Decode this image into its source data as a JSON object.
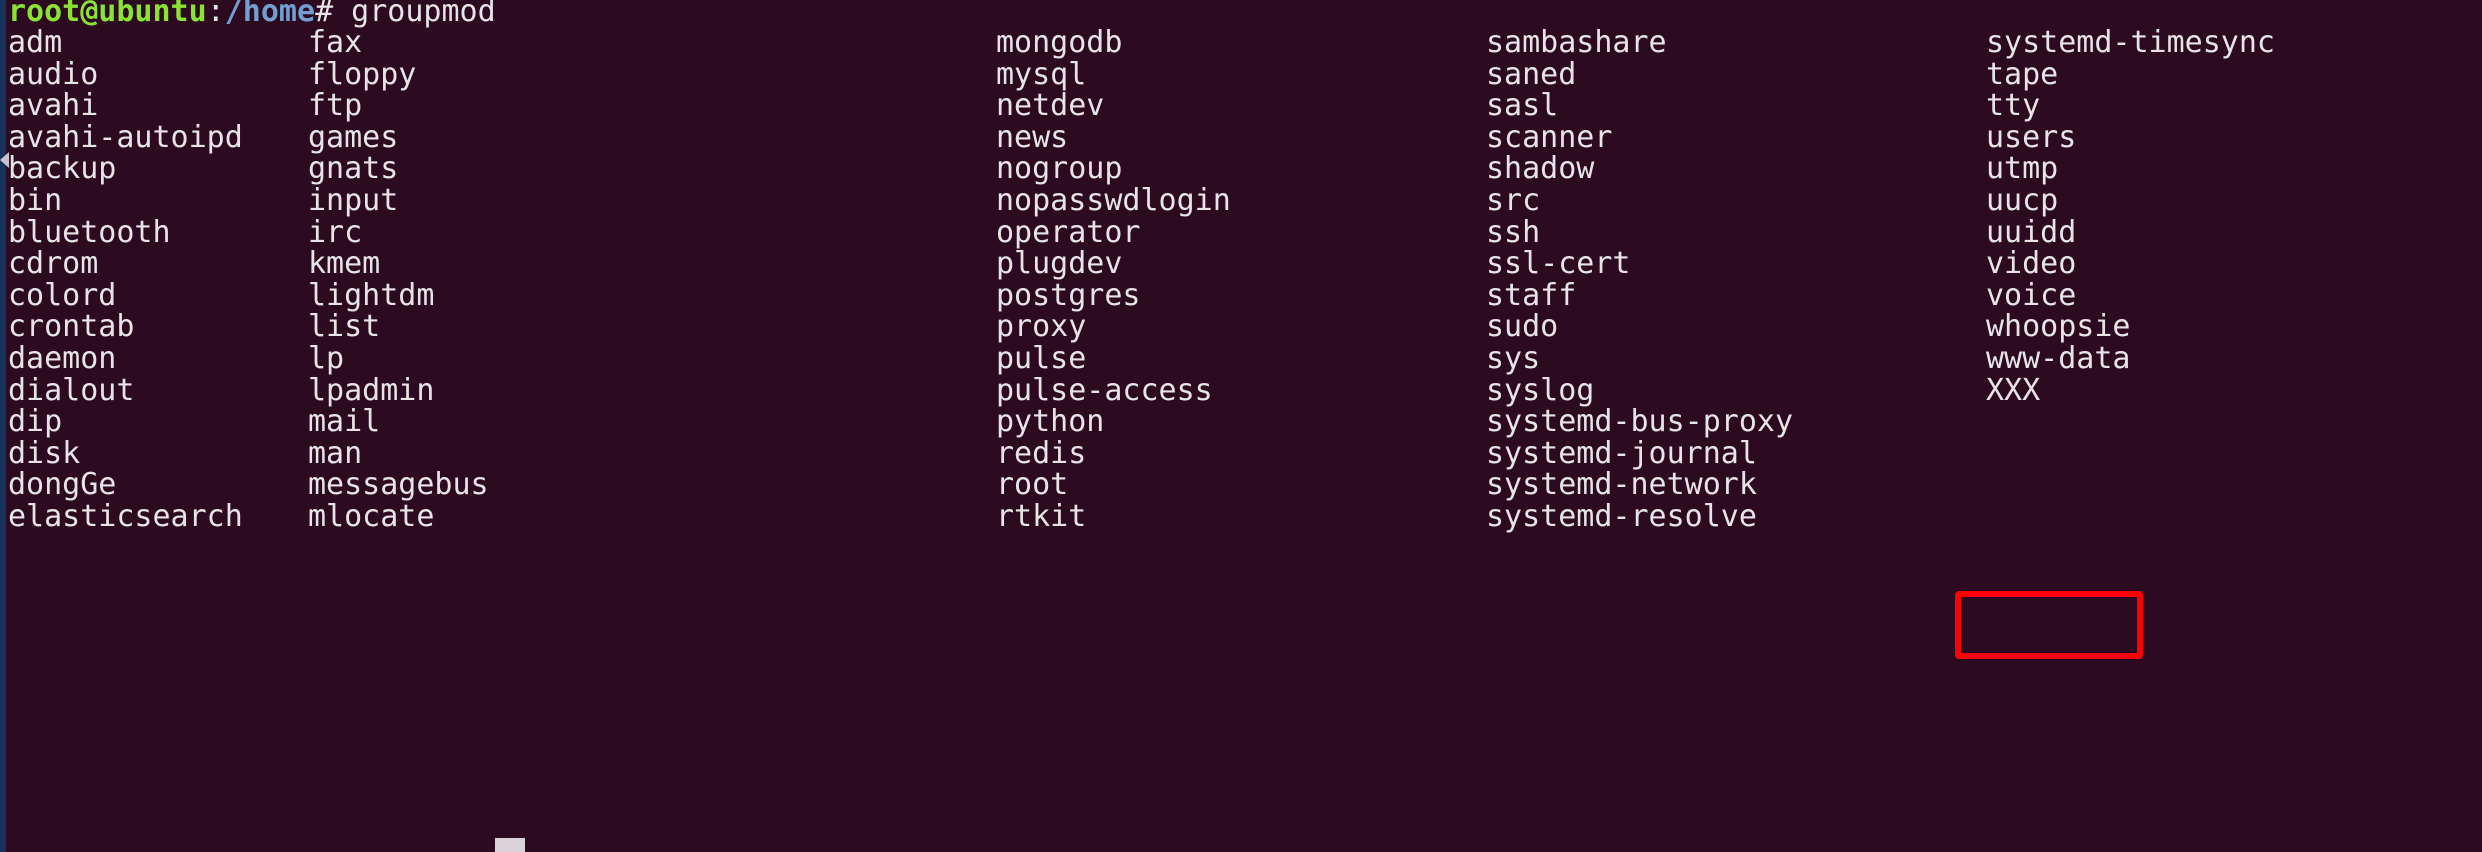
{
  "terminal": {
    "background_color": "#2c0a20",
    "foreground_color": "#e8e4e6",
    "prompt": {
      "user_host": "root@ubuntu",
      "user_host_color": "#8ae234",
      "separator": ":",
      "path": "/home",
      "path_color": "#729fcf",
      "sigil": "#",
      "command": " groupmod"
    },
    "cursor": {
      "name": "block-cursor",
      "color": "#d9d2d8"
    },
    "scrollbar": {
      "name": "left-scrollbar",
      "track_color": "#1b2340",
      "thumb_color": "#16325c",
      "marker_color": "#c9c3d0"
    }
  },
  "annotation": {
    "highlight_color": "#fb0007",
    "highlighted_text": "XXX"
  },
  "columns": [
    {
      "name": "column-1",
      "items": [
        "adm",
        "audio",
        "avahi",
        "avahi-autoipd",
        "backup",
        "bin",
        "bluetooth",
        "cdrom",
        "colord",
        "crontab",
        "daemon",
        "dialout",
        "dip",
        "disk",
        "dongGe",
        "elasticsearch"
      ]
    },
    {
      "name": "column-2",
      "items": [
        "fax",
        "floppy",
        "ftp",
        "games",
        "gnats",
        "input",
        "irc",
        "kmem",
        "lightdm",
        "list",
        "lp",
        "lpadmin",
        "mail",
        "man",
        "messagebus",
        "mlocate"
      ]
    },
    {
      "name": "column-3",
      "items": [
        "mongodb",
        "mysql",
        "netdev",
        "news",
        "nogroup",
        "nopasswdlogin",
        "operator",
        "plugdev",
        "postgres",
        "proxy",
        "pulse",
        "pulse-access",
        "python",
        "redis",
        "root",
        "rtkit"
      ]
    },
    {
      "name": "column-4",
      "items": [
        "sambashare",
        "saned",
        "sasl",
        "scanner",
        "shadow",
        "src",
        "ssh",
        "ssl-cert",
        "staff",
        "sudo",
        "sys",
        "syslog",
        "systemd-bus-proxy",
        "systemd-journal",
        "systemd-network",
        "systemd-resolve"
      ]
    },
    {
      "name": "column-5",
      "items": [
        "systemd-timesync",
        "tape",
        "tty",
        "users",
        "utmp",
        "uucp",
        "uuidd",
        "video",
        "voice",
        "whoopsie",
        "www-data",
        "XXX"
      ]
    }
  ]
}
